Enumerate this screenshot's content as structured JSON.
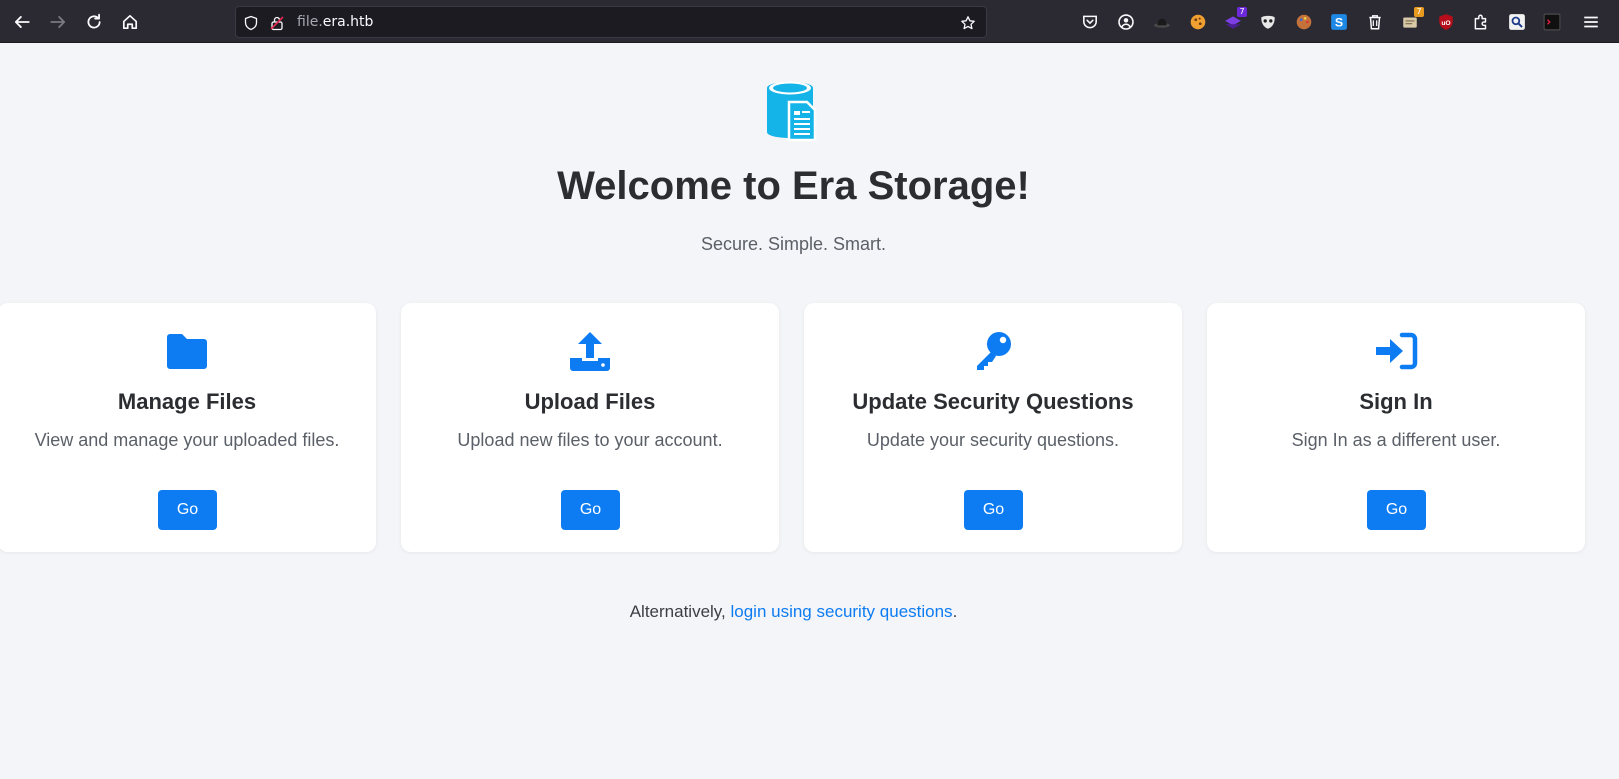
{
  "browser": {
    "url_prefix": "file.",
    "url_domain": "era.htb",
    "extensions": [
      {
        "icon": "pocket-icon"
      },
      {
        "icon": "account-icon"
      },
      {
        "icon": "hat-icon"
      },
      {
        "icon": "cookie-icon"
      },
      {
        "icon": "wappalyzer-icon",
        "badge": "7"
      },
      {
        "icon": "mask-icon"
      },
      {
        "icon": "palette-icon"
      },
      {
        "icon": "s-extension-icon"
      },
      {
        "icon": "trash-icon"
      },
      {
        "icon": "notes-icon",
        "badge": "7"
      },
      {
        "icon": "ublock-icon"
      },
      {
        "icon": "puzzle-icon"
      },
      {
        "icon": "search-ext-icon"
      },
      {
        "icon": "terminal-ext-icon"
      },
      {
        "icon": "menu-icon"
      }
    ]
  },
  "hero": {
    "title": "Welcome to Era Storage!",
    "subtitle": "Secure. Simple. Smart."
  },
  "cards": [
    {
      "icon": "folder-icon",
      "title": "Manage Files",
      "description": "View and manage your uploaded files.",
      "button": "Go"
    },
    {
      "icon": "upload-icon",
      "title": "Upload Files",
      "description": "Upload new files to your account.",
      "button": "Go"
    },
    {
      "icon": "key-icon",
      "title": "Update Security Questions",
      "description": "Update your security questions.",
      "button": "Go"
    },
    {
      "icon": "sign-in-icon",
      "title": "Sign In",
      "description": "Sign In as a different user.",
      "button": "Go"
    }
  ],
  "footer": {
    "prefix": "Alternatively, ",
    "link": "login using security questions",
    "suffix": "."
  },
  "colors": {
    "accent": "#0d7cf2",
    "logo": "#14b4e8",
    "background": "#f4f5f8"
  }
}
